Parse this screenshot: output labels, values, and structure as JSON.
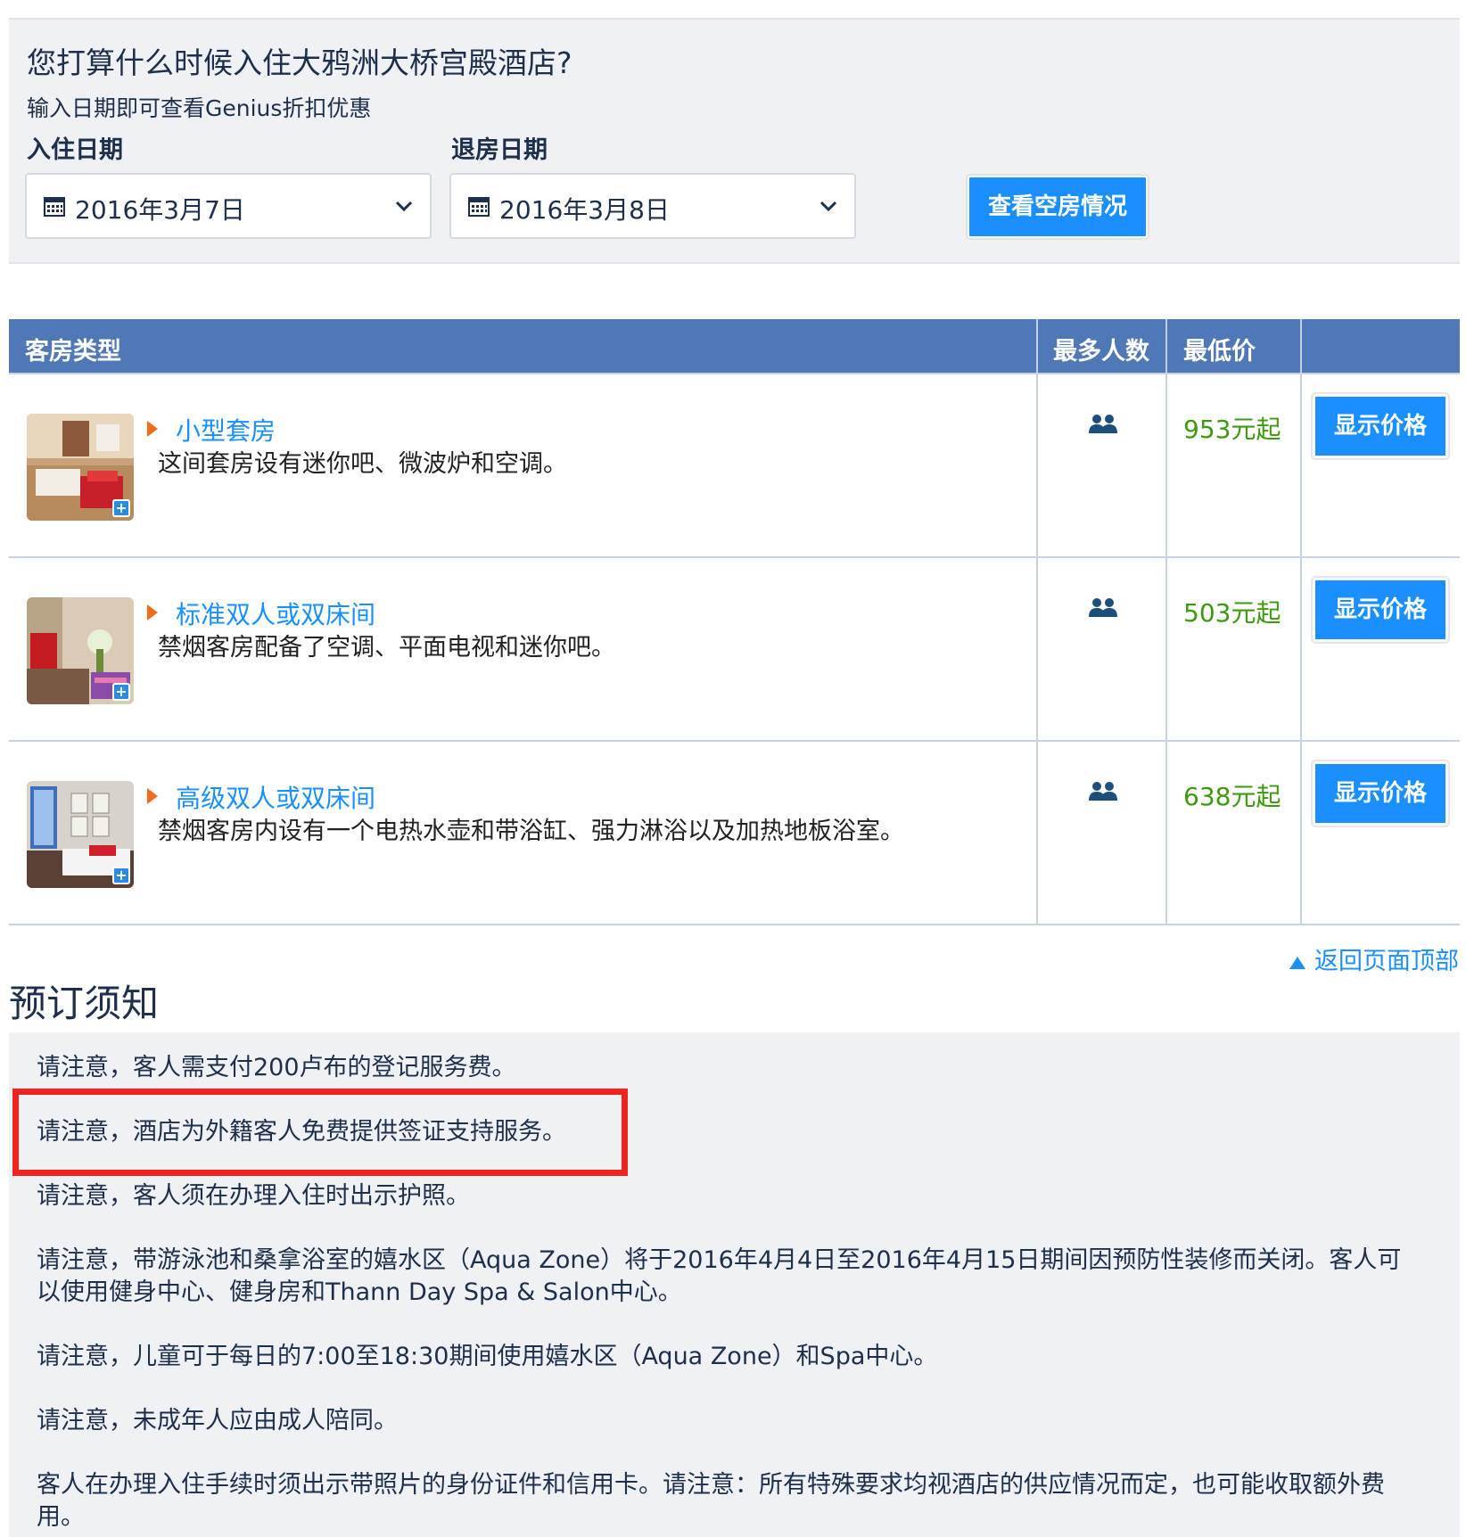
{
  "availability": {
    "title": "您打算什么时候入住大鸦洲大桥宫殿酒店?",
    "subtitle": "输入日期即可查看Genius折扣优惠",
    "checkin_label": "入住日期",
    "checkin_value": "2016年3月7日",
    "checkout_label": "退房日期",
    "checkout_value": "2016年3月8日",
    "check_button": "查看空房情况"
  },
  "room_table": {
    "headers": {
      "room_type": "客房类型",
      "max_guests": "最多人数",
      "lowest_price": "最低价"
    },
    "rooms": [
      {
        "name": "小型套房",
        "desc": "这间套房设有迷你吧、微波炉和空调。",
        "price": "953元起",
        "button": "显示价格"
      },
      {
        "name": "标准双人或双床间",
        "desc": "禁烟客房配备了空调、平面电视和迷你吧。",
        "price": "503元起",
        "button": "显示价格"
      },
      {
        "name": "高级双人或双床间",
        "desc": "禁烟客房内设有一个电热水壶和带浴缸、强力淋浴以及加热地板浴室。",
        "price": "638元起",
        "button": "显示价格"
      }
    ]
  },
  "back_to_top": "返回页面顶部",
  "policy": {
    "title": "预订须知",
    "notes": [
      "请注意，客人需支付200卢布的登记服务费。",
      "请注意，酒店为外籍客人免费提供签证支持服务。",
      "请注意，客人须在办理入住时出示护照。",
      "请注意，带游泳池和桑拿浴室的嬉水区（Aqua Zone）将于2016年4月4日至2016年4月15日期间因预防性装修而关闭。客人可",
      "以使用健身中心、健身房和Thann Day Spa & Salon中心。",
      "请注意，儿童可于每日的7:00至18:30期间使用嬉水区（Aqua Zone）和Spa中心。",
      "请注意，未成年人应由成人陪同。",
      "客人在办理入住手续时须出示带照片的身份证件和信用卡。请注意：所有特殊要求均视酒店的供应情况而定，也可能收取额外费",
      "用。"
    ]
  },
  "colors": {
    "accent": "#1a8fff",
    "header_bg": "#5077b6",
    "price": "#3d9a0f",
    "highlight_box": "#f0241c"
  }
}
